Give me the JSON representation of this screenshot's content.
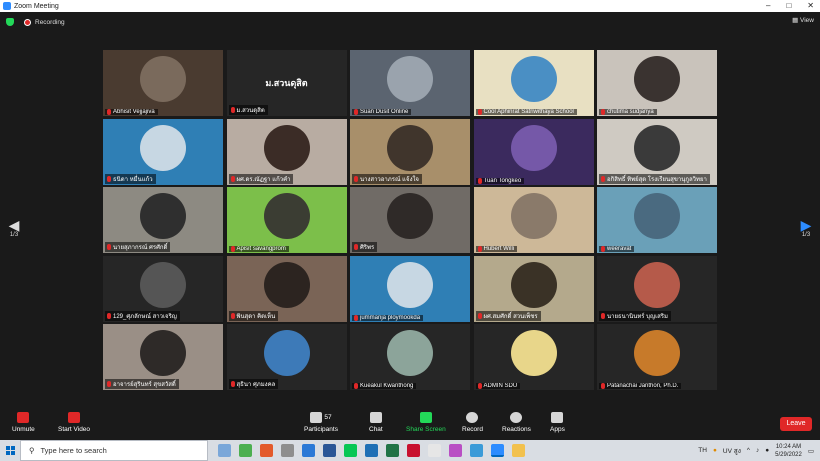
{
  "window": {
    "title": "Zoom Meeting",
    "controls": [
      "–",
      "□",
      "✕"
    ]
  },
  "topbar": {
    "recording": "Recording",
    "view": "View"
  },
  "pager": {
    "left": "1/3",
    "right": "1/3"
  },
  "tiles": [
    {
      "name": "Abhisit Vejjajiva",
      "bg": "#4a3b30",
      "ph": "#7a6a5c"
    },
    {
      "name": "ม.สวนดุสิต",
      "bg": "#262626",
      "card": "ม.สวนดุสิต"
    },
    {
      "name": "Suan Dusit Online",
      "bg": "#5b6470",
      "ph": "#9aa3ad"
    },
    {
      "name": "Cool Aphinrat Satriwithaya School",
      "bg": "#e8e0c2",
      "ph": "#4a8fc4"
    },
    {
      "name": "chutima sudjanya",
      "bg": "#c9c3bb",
      "ph": "#3a3330"
    },
    {
      "name": "ธนิดา หมื่นแก้ว",
      "bg": "#2f7fb5",
      "ph": "#c7d7e3"
    },
    {
      "name": "ผศ.ดร.ณัฏฐา แก้วคำ",
      "bg": "#b8aca2",
      "ph": "#3b2c26"
    },
    {
      "name": "นางสาวอาภรณ์ แจ้งใจ",
      "bg": "#a88f6a",
      "ph": "#40352c"
    },
    {
      "name": "Tuan Tongkeo",
      "bg": "#3b2a5e",
      "ph": "#7558a8"
    },
    {
      "name": "อกิสิทธิ์ ทิพย์สุด โรงเรียนสุขานุกูลวิทยา",
      "bg": "#cfcac2",
      "ph": "#3a3a3a"
    },
    {
      "name": "นายสุภากรณ์ ศรศักดิ์",
      "bg": "#8d8a82",
      "ph": "#2f2f2f"
    },
    {
      "name": "Apisit savangprom",
      "bg": "#7cbf4a",
      "ph": "#3b3d33"
    },
    {
      "name": "ศิริพร",
      "bg": "#706b66",
      "ph": "#2f2a28"
    },
    {
      "name": "Hubert Willi",
      "bg": "#cdb898",
      "ph": "#8a7a6a"
    },
    {
      "name": "weeravat",
      "bg": "#6aa0b8",
      "ph": "#4a6a80"
    },
    {
      "name": "129_ศุภลักษณ์ สาวเจริญ",
      "bg": "#262626",
      "ph": "#555"
    },
    {
      "name": "พินสุดา คิดเห็น",
      "bg": "#7a6456",
      "ph": "#2c2420"
    },
    {
      "name": "jummanja ploymookda",
      "bg": "#2f7fb5",
      "ph": "#c7d7e3"
    },
    {
      "name": "ผศ.สมศักดิ์ สวนเพ็ชร",
      "bg": "#b4a98c",
      "ph": "#3a3226"
    },
    {
      "name": "นายธนานินทร์ บุญเสริม",
      "bg": "#262626",
      "ph": "#b55a4a"
    },
    {
      "name": "อาจารย์สุรินทร์ สุขสวัสดิ์",
      "bg": "#9a8f86",
      "ph": "#2e2a28"
    },
    {
      "name": "สุธินา ศุภมงคล",
      "bg": "#262626",
      "ph": "#3d7ab8"
    },
    {
      "name": "Kueakul Kwanthong",
      "bg": "#262626",
      "ph": "#8ca49a"
    },
    {
      "name": "ADMIN SDU",
      "bg": "#262626",
      "ph": "#e8d68a"
    },
    {
      "name": "Patanachai Janthon, Ph.D.",
      "bg": "#262626",
      "ph": "#c77a2a"
    }
  ],
  "toolbar": {
    "unmute": "Unmute",
    "start_video": "Start Video",
    "participants": "Participants",
    "participant_count": "57",
    "chat": "Chat",
    "share_screen": "Share Screen",
    "record": "Record",
    "reactions": "Reactions",
    "apps": "Apps",
    "leave": "Leave"
  },
  "taskbar": {
    "search_placeholder": "Type here to search",
    "lang": "TH",
    "uv": "UV สูง",
    "time": "10:24 AM",
    "date": "5/29/2022"
  }
}
